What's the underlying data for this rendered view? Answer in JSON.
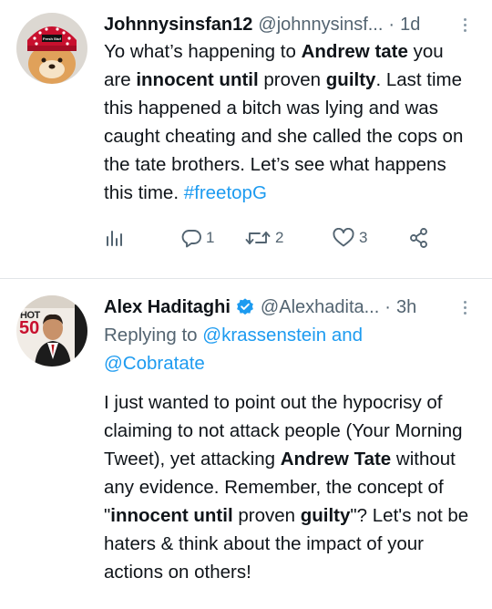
{
  "tweets": [
    {
      "name": "Johnnysinsfan12",
      "handle": "@johnnysinsf...",
      "time": "1d",
      "text_parts": [
        "Yo what’s happening to ",
        "Andrew tate",
        " you are ",
        "innocent until",
        " proven ",
        "guilty",
        ". Last time this happened a bitch was lying and was caught cheating and she called the cops on the tate brothers. Let’s see what happens this time. ",
        "#freetopG"
      ],
      "avatar_hat_text": "Fresh Stuff",
      "actions": {
        "replies": "1",
        "retweets": "2",
        "likes": "3"
      },
      "icons": [
        "analytics-icon",
        "reply-icon",
        "retweet-icon",
        "like-icon",
        "share-icon"
      ]
    },
    {
      "name": "Alex Haditaghi",
      "handle": "@Alexhadita...",
      "time": "3h",
      "reply_prefix": "Replying to ",
      "reply_user1": "@krassenstein",
      "reply_and": " and",
      "reply_user2": "@Cobratate",
      "avatar_mag_text": "HOT",
      "avatar_mag_number": "50",
      "text_parts": [
        "I just wanted to point out the hypocrisy of claiming to not attack people (Your Morning Tweet), yet attacking ",
        "Andrew Tate",
        " without any evidence. Remember, the concept of \"",
        "innocent until",
        " proven ",
        "guilty",
        "\"? Let's not be haters & think about the impact of your actions on others!"
      ]
    }
  ],
  "colors": {
    "link": "#1d9bf0",
    "secondary": "#536471",
    "text": "#0f1419",
    "verified": "#1d9bf0"
  }
}
